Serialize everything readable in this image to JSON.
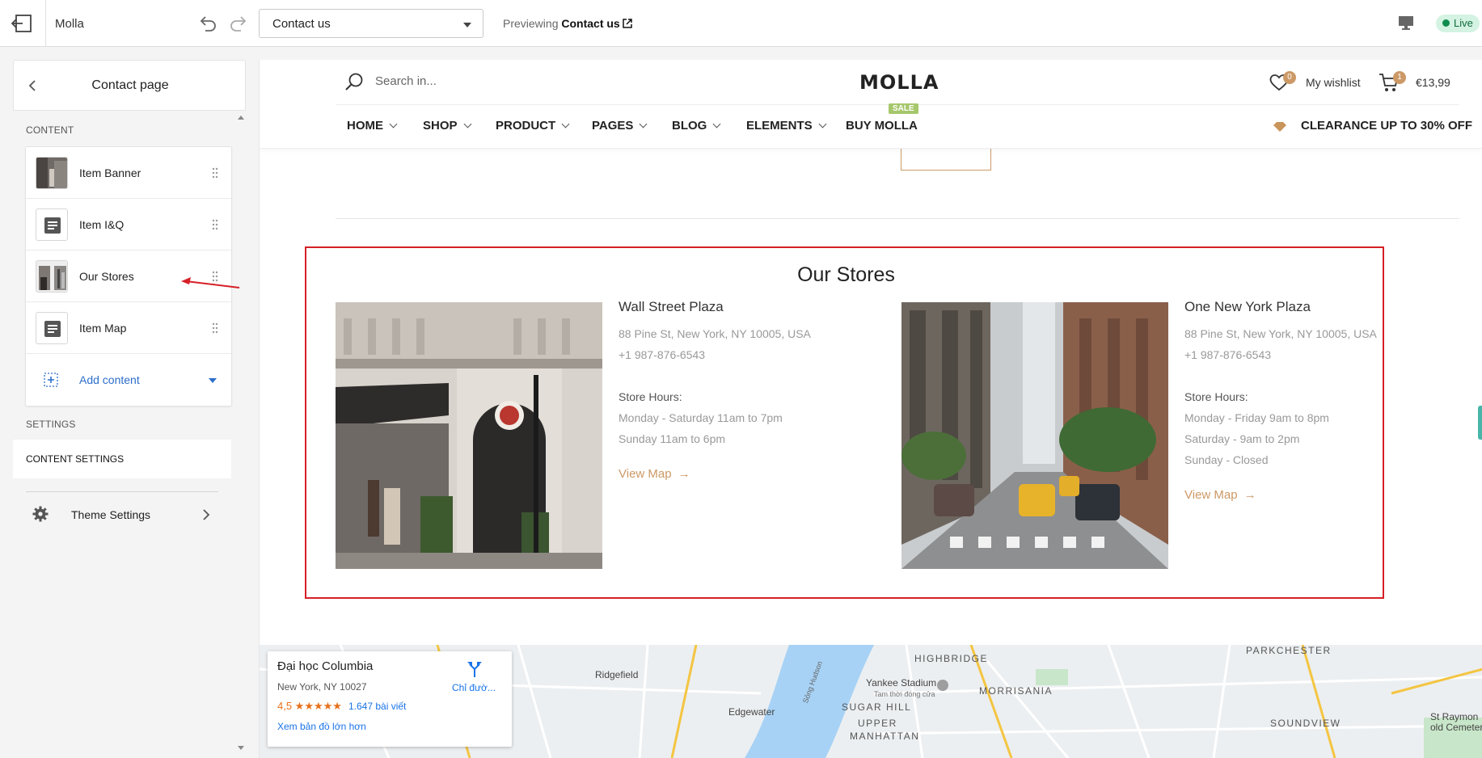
{
  "topbar": {
    "store_name": "Molla",
    "page_select_value": "Contact us",
    "previewing_prefix": "Previewing ",
    "previewing_page": "Contact us",
    "live_label": "Live"
  },
  "sidebar": {
    "title": "Contact page",
    "content_label": "CONTENT",
    "items": [
      {
        "label": "Item Banner",
        "thumb": "image"
      },
      {
        "label": "Item I&Q",
        "thumb": "text-icon"
      },
      {
        "label": "Our Stores",
        "thumb": "image"
      },
      {
        "label": "Item Map",
        "thumb": "text-icon"
      }
    ],
    "add_content": "Add content",
    "settings_label": "SETTINGS",
    "content_settings": "CONTENT SETTINGS",
    "theme_settings": "Theme Settings"
  },
  "site": {
    "search_placeholder": "Search in...",
    "logo": "MOLLA",
    "wishlist_count": "0",
    "wishlist_label": "My wishlist",
    "cart_count": "1",
    "cart_total": "€13,99",
    "nav": [
      "HOME",
      "SHOP",
      "PRODUCT",
      "PAGES",
      "BLOG",
      "ELEMENTS",
      "BUY MOLLA"
    ],
    "sale_tag": "SALE",
    "clearance": "CLEARANCE UP TO 30% OFF"
  },
  "stores": {
    "title": "Our Stores",
    "list": [
      {
        "name": "Wall Street Plaza",
        "address": "88 Pine St, New York, NY 10005, USA",
        "phone": "+1 987-876-6543",
        "hours_title": "Store Hours:",
        "hours": [
          "Monday - Saturday 11am to 7pm",
          "Sunday 11am to 6pm"
        ],
        "view_map": "View Map"
      },
      {
        "name": "One New York Plaza",
        "address": "88 Pine St, New York, NY 10005, USA",
        "phone": "+1 987-876-6543",
        "hours_title": "Store Hours:",
        "hours": [
          "Monday - Friday 9am to 8pm",
          "Saturday - 9am to 2pm",
          "Sunday - Closed"
        ],
        "view_map": "View Map"
      }
    ]
  },
  "map": {
    "place": "Đại học Columbia",
    "place_address": "New York, NY 10027",
    "rating": "4,5 ★★★★★",
    "reviews": "1.647 bài viết",
    "bigger_map": "Xem bản đồ lớn hơn",
    "directions": "Chỉ đườ...",
    "labels": {
      "ridgefield": "Ridgefield",
      "edgewater": "Edgewater",
      "highbridge": "HIGHBRIDGE",
      "yankee": "Yankee Stadium",
      "yankee_sub": "Tam thời đóng cửa",
      "morrisania": "MORRISANIA",
      "sugar_hill": "SUGAR HILL",
      "upper": "UPPER",
      "manhattan": "MANHATTAN",
      "parkchester": "PARKCHESTER",
      "soundview": "SOUNDVIEW",
      "st_raymond": "St Raymon",
      "old_cemetery": "old Cemeter",
      "hudson": "Sông Hudson"
    }
  },
  "colors": {
    "accent": "#cc9966",
    "highlight_border": "#d61f26",
    "link_blue": "#2c6ecb",
    "live_green": "#118c4f"
  }
}
